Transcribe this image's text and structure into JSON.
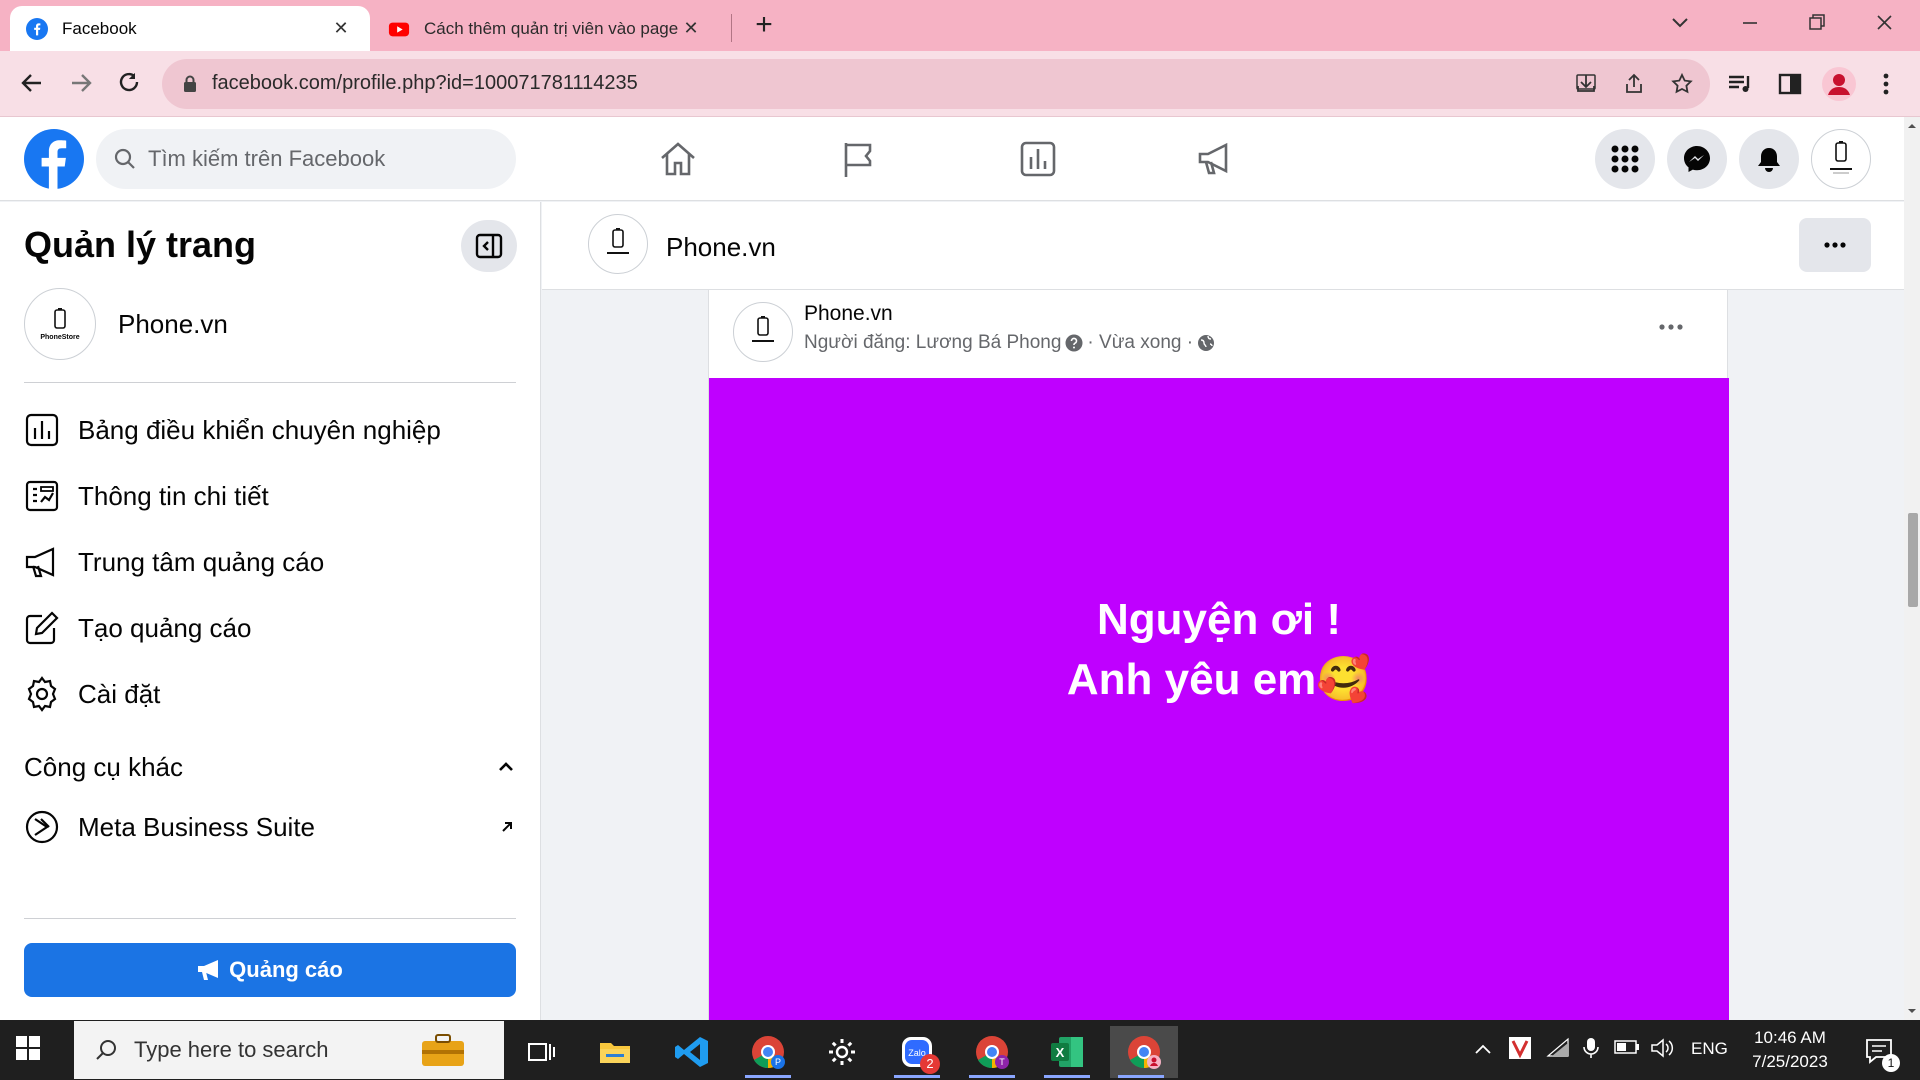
{
  "browser": {
    "tabs": [
      {
        "title": "Facebook",
        "active": true
      },
      {
        "title": "Cách thêm quản trị viên vào page",
        "active": false
      }
    ],
    "new_tab": "+",
    "url": "facebook.com/profile.php?id=100071781114235"
  },
  "facebook": {
    "search_placeholder": "Tìm kiếm trên Facebook"
  },
  "sidebar": {
    "title": "Quản lý trang",
    "page_name": "Phone.vn",
    "avatar_text": "PhoneStore",
    "items": [
      {
        "label": "Bảng điều khiển chuyên nghiệp",
        "icon": "dashboard-icon"
      },
      {
        "label": "Thông tin chi tiết",
        "icon": "insights-icon"
      },
      {
        "label": "Trung tâm quảng cáo",
        "icon": "megaphone-icon"
      },
      {
        "label": "Tạo quảng cáo",
        "icon": "edit-icon"
      },
      {
        "label": "Cài đặt",
        "icon": "gear-icon"
      }
    ],
    "section_label": "Công cụ khác",
    "tools": [
      {
        "label": "Meta Business Suite",
        "icon": "meta-business-icon"
      }
    ],
    "ads_button": "Quảng cáo"
  },
  "page_header": {
    "name": "Phone.vn"
  },
  "post": {
    "author": "Phone.vn",
    "posted_by": "Người đăng: Lương Bá Phong",
    "time": "· Vừa xong ·",
    "line1": "Nguyện ơi !",
    "line2": "Anh yêu em",
    "emoji": "🥰",
    "background_color": "#bf00ff"
  },
  "taskbar": {
    "search_placeholder": "Type here to search",
    "zalo_badge": "2",
    "language": "ENG",
    "time": "10:46 AM",
    "date": "7/25/2023",
    "notification_count": "1"
  },
  "colors": {
    "tab_strip": "#f6b2c4",
    "toolbar": "#f8dfe6",
    "facebook_blue": "#1877f2",
    "ads_button": "#1b74e4"
  }
}
